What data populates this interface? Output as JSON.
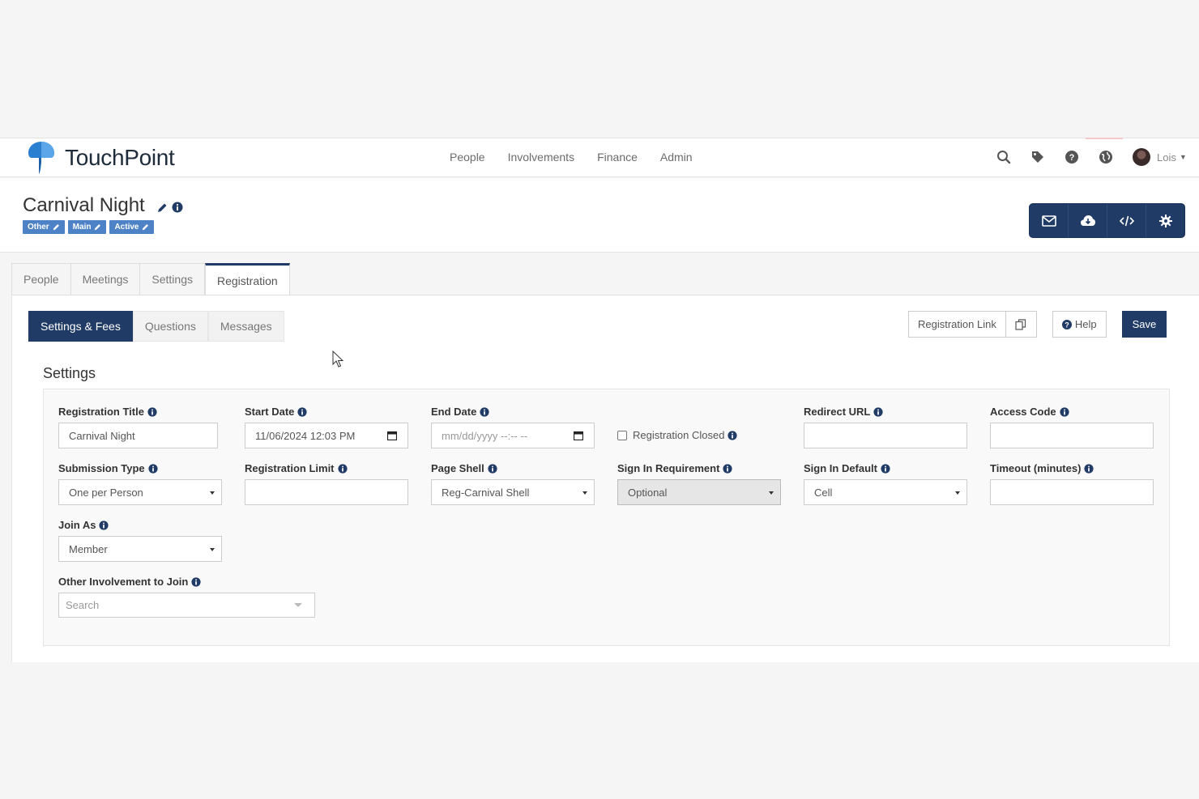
{
  "brand": {
    "name": "TouchPoint"
  },
  "nav": {
    "links": [
      "People",
      "Involvements",
      "Finance",
      "Admin"
    ],
    "icons": [
      "search-icon",
      "tag-icon",
      "question-circle-icon",
      "globe-icon"
    ],
    "user_name": "Lois"
  },
  "header": {
    "title": "Carnival Night",
    "badges": [
      "Other",
      "Main",
      "Active"
    ]
  },
  "main_tabs": [
    "People",
    "Meetings",
    "Settings",
    "Registration"
  ],
  "main_tab_active": "Registration",
  "sub_tabs": [
    "Settings & Fees",
    "Questions",
    "Messages"
  ],
  "sub_tab_active": "Settings & Fees",
  "buttons": {
    "registration_link": "Registration Link",
    "help": "Help",
    "save": "Save"
  },
  "section_title": "Settings",
  "form": {
    "registration_title": {
      "label": "Registration Title",
      "value": "Carnival Night"
    },
    "start_date": {
      "label": "Start Date",
      "value": "11/06/2024 12:03 PM"
    },
    "end_date": {
      "label": "End Date",
      "placeholder": "mm/dd/yyyy --:-- --"
    },
    "registration_closed": {
      "label": "Registration Closed",
      "checked": false
    },
    "redirect_url": {
      "label": "Redirect URL",
      "value": ""
    },
    "access_code": {
      "label": "Access Code",
      "value": ""
    },
    "submission_type": {
      "label": "Submission Type",
      "value": "One per Person"
    },
    "registration_limit": {
      "label": "Registration Limit",
      "value": ""
    },
    "page_shell": {
      "label": "Page Shell",
      "value": "Reg-Carnival Shell"
    },
    "sign_in_requirement": {
      "label": "Sign In Requirement",
      "value": "Optional"
    },
    "sign_in_default": {
      "label": "Sign In Default",
      "value": "Cell"
    },
    "timeout": {
      "label": "Timeout (minutes)",
      "value": ""
    },
    "join_as": {
      "label": "Join As",
      "value": "Member"
    },
    "other_involvement": {
      "label": "Other Involvement to Join",
      "placeholder": "Search"
    }
  },
  "colors": {
    "primary": "#1f3b66",
    "badge": "#4e82c6",
    "brand_logo": "#2b7fd0"
  }
}
